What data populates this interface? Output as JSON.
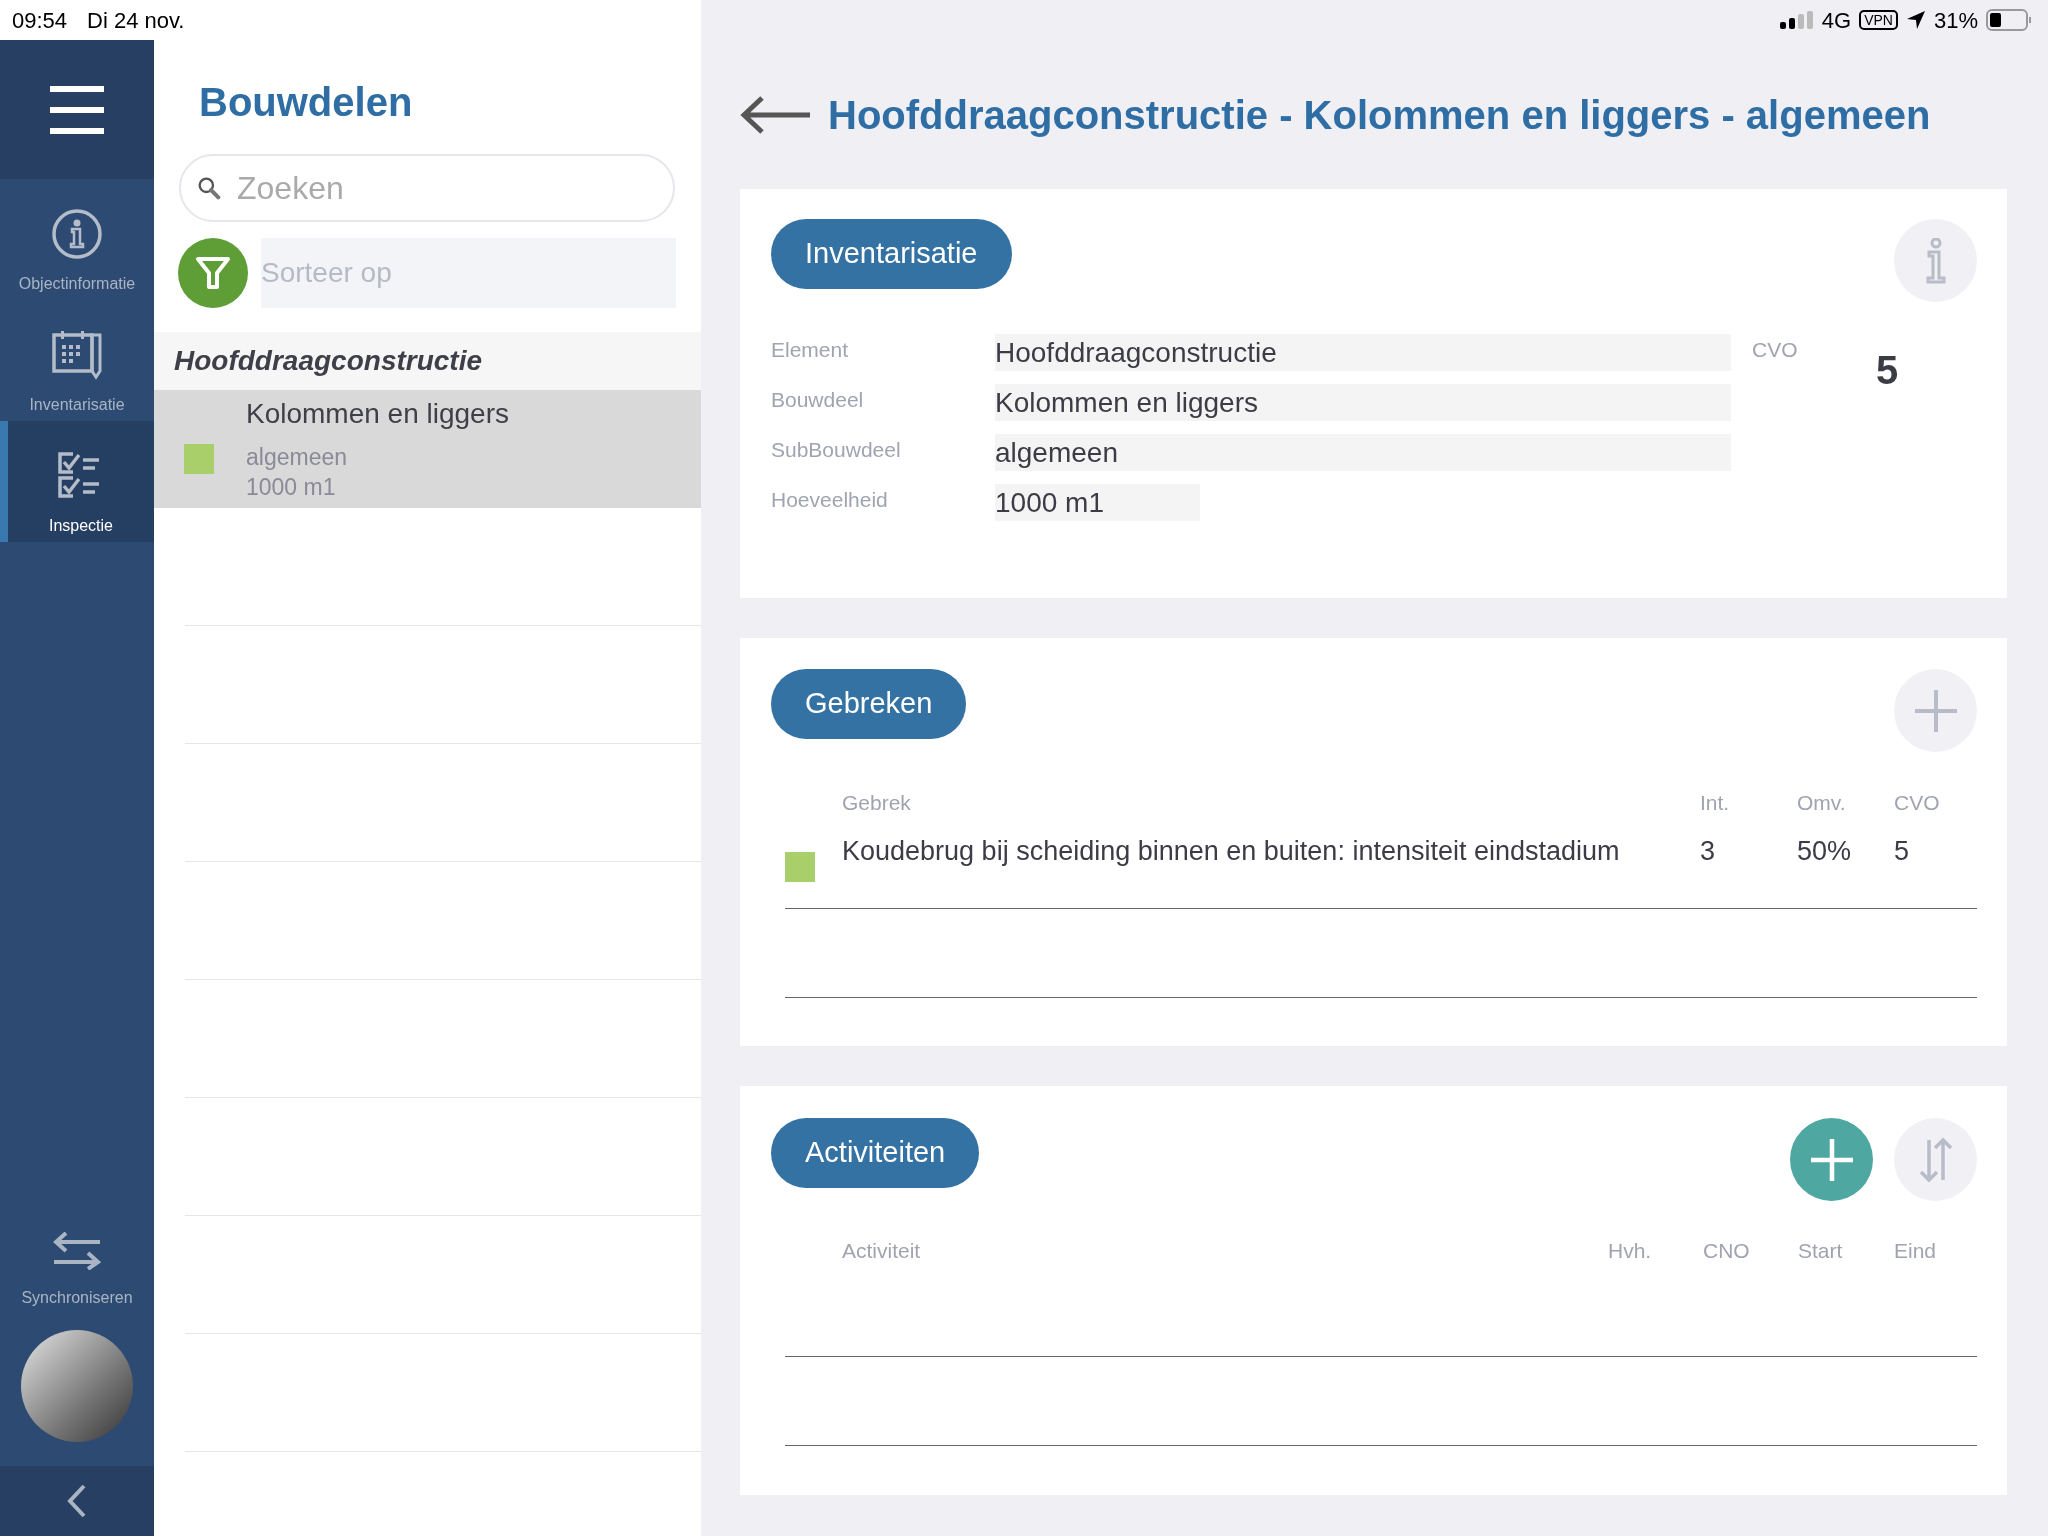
{
  "status_bar": {
    "time": "09:54",
    "date": "Di 24 nov.",
    "network": "4G",
    "vpn": "VPN",
    "battery": "31%"
  },
  "sidebar": {
    "items": [
      {
        "label": "Objectinformatie",
        "selected": false
      },
      {
        "label": "Inventarisatie",
        "selected": false
      },
      {
        "label": "Inspectie",
        "selected": true
      }
    ],
    "sync": {
      "label": "Synchroniseren"
    }
  },
  "list": {
    "title": "Bouwdelen",
    "search": {
      "placeholder": "Zoeken"
    },
    "sort": {
      "placeholder": "Sorteer op"
    },
    "groups": [
      {
        "title": "Hoofddraagconstructie",
        "items": [
          {
            "title": "Kolommen en liggers",
            "subtitle": "algemeen",
            "quantity": "1000 m1",
            "color": "#a8cf6a",
            "selected": true
          }
        ]
      }
    ]
  },
  "detail": {
    "title": "Hoofddraagconstructie - Kolommen en liggers - algemeen",
    "inventory": {
      "button": "Inventarisatie",
      "fields": [
        {
          "label": "Element",
          "value": "Hoofddraagconstructie"
        },
        {
          "label": "Bouwdeel",
          "value": "Kolommen en liggers"
        },
        {
          "label": "SubBouwdeel",
          "value": "algemeen"
        },
        {
          "label": "Hoeveelheid",
          "value": "1000 m1"
        }
      ],
      "cvo_label": "CVO",
      "cvo_value": "5"
    },
    "defects": {
      "button": "Gebreken",
      "columns": [
        "Gebrek",
        "Int.",
        "Omv.",
        "CVO"
      ],
      "rows": [
        {
          "color": "#a8cf6a",
          "cells": [
            "Koudebrug bij scheiding binnen en buiten: intensiteit eindstadium",
            "3",
            "50%",
            "5"
          ]
        }
      ]
    },
    "activities": {
      "button": "Activiteiten",
      "columns": [
        "Activiteit",
        "Hvh.",
        "CNO",
        "Start",
        "Eind"
      ]
    }
  }
}
